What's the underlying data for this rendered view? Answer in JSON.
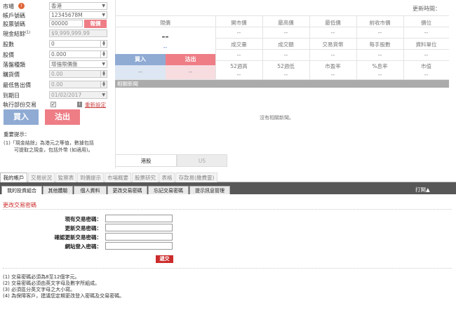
{
  "order_form": {
    "market_label": "市場",
    "market_value": "香港",
    "account_label": "帳戶號碼",
    "account_value": "12345678M",
    "stock_label": "股票號碼",
    "stock_value": "00000",
    "search_label": "報價",
    "cash_label": "現金結餘",
    "cash_sup": "(1)",
    "cash_value": "$9,999,999.99",
    "qty_label": "股數",
    "qty_value": "0",
    "price_label": "股價",
    "price_value": "0.000",
    "order_type_label": "落盤種類",
    "order_type_value": "增強限價盤",
    "bid_label": "購貨價",
    "bid_value": "0.00",
    "min_sell_label": "最低售出價",
    "min_sell_value": "0.00",
    "expiry_label": "到期日",
    "expiry_value": "01/02/2017",
    "partial_label": "執行部份交易",
    "reset_label": "重新設定",
    "buy_label": "買入",
    "sell_label": "沽出",
    "notes_title": "重要提示：",
    "notes_line1": "(1)「現金結餘」為港元之等值，數據包括",
    "notes_line2": "可提取之現金，包括外幣 (如適用)。"
  },
  "quote": {
    "update_time_label": "更新時間：",
    "current_price_label": "現價",
    "current_price_value": "--",
    "change_value": "--",
    "open_label": "開市價",
    "high_label": "最高價",
    "low_label": "最低價",
    "prev_close_label": "前收市價",
    "spread_label": "價位",
    "volume_label": "成交量",
    "turnover_label": "成交額",
    "currency_label": "交易貨幣",
    "lot_label": "每手股數",
    "unit_label": "資料單位",
    "w52_high_label": "52週高",
    "w52_low_label": "52週低",
    "pe_label": "市盈率",
    "yield_label": "%息率",
    "mktcap_label": "市值",
    "dash": "--",
    "buy_header": "買入",
    "sell_header": "沽出",
    "news_header": "相關新聞",
    "no_news": "沒有相關新聞。",
    "hk_button": "港股",
    "us_button": "US"
  },
  "tabs_top": [
    "我的帳戶",
    "交易狀況",
    "監察表",
    "到價提示",
    "市場概要",
    "股票研究",
    "表格",
    "存款易(繳費靈)"
  ],
  "tabs_sub": [
    "我的投資組合",
    "其他體驗",
    "個人資料",
    "更改交易密碼",
    "忘記交易密碼",
    "提示訊息管理"
  ],
  "print_label": "打開▲",
  "password_form": {
    "title": "更改交易密碼",
    "current_label": "現有交易密碼：",
    "new_label": "更新交易密碼：",
    "confirm_label": "確認更新交易密碼：",
    "login_label": "網站登入密碼：",
    "submit_label": "遞交"
  },
  "rules": [
    "(1) 交易密碼必須為8至12個字元。",
    "(2) 交易密碼必須由英文字母及數字所組成。",
    "(3) 必須區分英文字母之大小寫。",
    "(4) 為保障客戶，建議您定期更改登入密碼及交易密碼。"
  ],
  "colors": {
    "buy": "#8fabd4",
    "sell": "#ee7d86",
    "submit": "#cc2b2b",
    "title_red": "#cc2b2b"
  }
}
